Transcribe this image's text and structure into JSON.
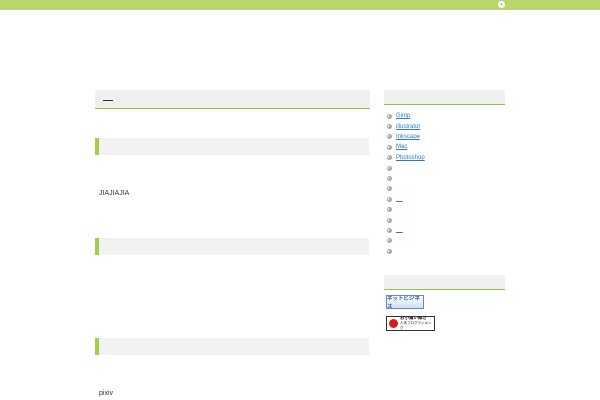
{
  "topbar": {
    "arrow_glyph": "›",
    "color": "#b8d66a"
  },
  "main": {
    "body_texts": [
      "JIAJIAJIA",
      "pixiv"
    ]
  },
  "sidebar": {
    "items": [
      {
        "label": "Gimp"
      },
      {
        "label": "illustrator"
      },
      {
        "label": "Inkscape"
      },
      {
        "label": "Mac"
      },
      {
        "label": "Photoshop"
      },
      {
        "label": ""
      },
      {
        "label": ""
      },
      {
        "label": ""
      },
      {
        "label": "__"
      },
      {
        "label": ""
      },
      {
        "label": ""
      },
      {
        "label": "__"
      },
      {
        "label": ""
      },
      {
        "label": ""
      }
    ],
    "banners": {
      "netbiz": "ネットビジネス",
      "blogranking_line1": "お小遣い稼ぎ",
      "blogranking_line2": "人気ブログランキング"
    }
  },
  "colors": {
    "accent_green": "#8ec641",
    "section_marker": "#a6cc4a",
    "link_blue": "#2a7ad0"
  }
}
